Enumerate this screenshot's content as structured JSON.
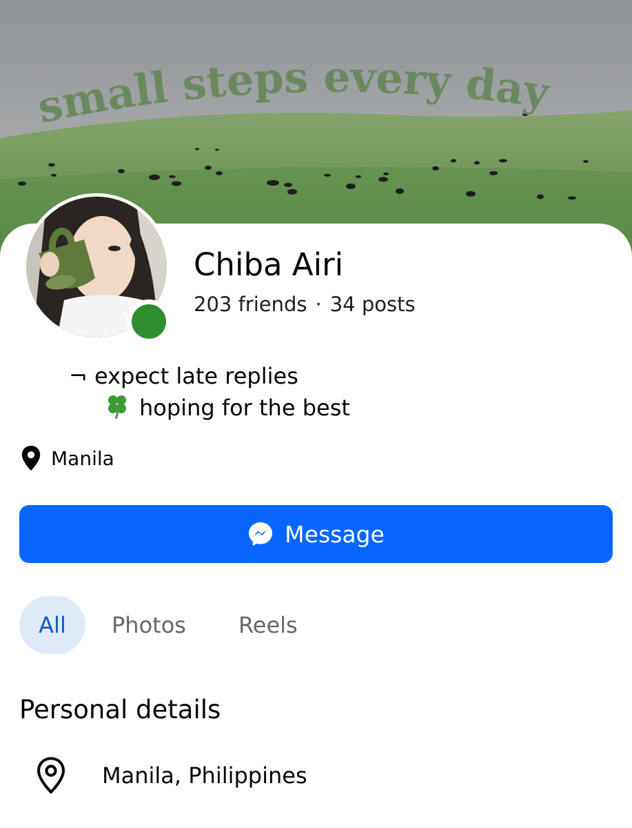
{
  "cover": {
    "overlay_text": "small steps every day"
  },
  "profile": {
    "name": "Chiba Airi",
    "friends": "203 friends",
    "separator": "·",
    "posts": "34 posts",
    "online_color": "#2f8f2f"
  },
  "bio": {
    "line1": "¬ expect late replies",
    "line2": "hoping for the best"
  },
  "location": {
    "label": "Manila"
  },
  "actions": {
    "message_label": "Message",
    "accent": "#0866ff"
  },
  "tabs": [
    {
      "label": "All",
      "active": true
    },
    {
      "label": "Photos",
      "active": false
    },
    {
      "label": "Reels",
      "active": false
    }
  ],
  "personal_details": {
    "title": "Personal details",
    "items": [
      {
        "icon": "location-pin-outline-icon",
        "text": "Manila, Philippines"
      }
    ]
  }
}
